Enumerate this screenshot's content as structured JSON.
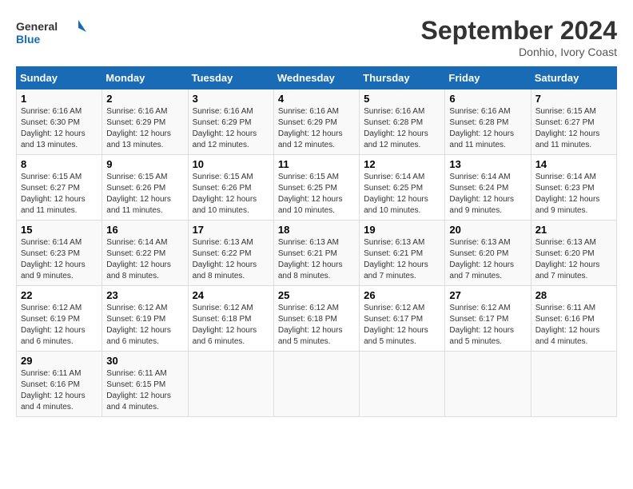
{
  "logo": {
    "line1": "General",
    "line2": "Blue"
  },
  "title": "September 2024",
  "location": "Donhio, Ivory Coast",
  "weekdays": [
    "Sunday",
    "Monday",
    "Tuesday",
    "Wednesday",
    "Thursday",
    "Friday",
    "Saturday"
  ],
  "weeks": [
    [
      {
        "day": "1",
        "info": "Sunrise: 6:16 AM\nSunset: 6:30 PM\nDaylight: 12 hours\nand 13 minutes."
      },
      {
        "day": "2",
        "info": "Sunrise: 6:16 AM\nSunset: 6:29 PM\nDaylight: 12 hours\nand 13 minutes."
      },
      {
        "day": "3",
        "info": "Sunrise: 6:16 AM\nSunset: 6:29 PM\nDaylight: 12 hours\nand 12 minutes."
      },
      {
        "day": "4",
        "info": "Sunrise: 6:16 AM\nSunset: 6:29 PM\nDaylight: 12 hours\nand 12 minutes."
      },
      {
        "day": "5",
        "info": "Sunrise: 6:16 AM\nSunset: 6:28 PM\nDaylight: 12 hours\nand 12 minutes."
      },
      {
        "day": "6",
        "info": "Sunrise: 6:16 AM\nSunset: 6:28 PM\nDaylight: 12 hours\nand 11 minutes."
      },
      {
        "day": "7",
        "info": "Sunrise: 6:15 AM\nSunset: 6:27 PM\nDaylight: 12 hours\nand 11 minutes."
      }
    ],
    [
      {
        "day": "8",
        "info": "Sunrise: 6:15 AM\nSunset: 6:27 PM\nDaylight: 12 hours\nand 11 minutes."
      },
      {
        "day": "9",
        "info": "Sunrise: 6:15 AM\nSunset: 6:26 PM\nDaylight: 12 hours\nand 11 minutes."
      },
      {
        "day": "10",
        "info": "Sunrise: 6:15 AM\nSunset: 6:26 PM\nDaylight: 12 hours\nand 10 minutes."
      },
      {
        "day": "11",
        "info": "Sunrise: 6:15 AM\nSunset: 6:25 PM\nDaylight: 12 hours\nand 10 minutes."
      },
      {
        "day": "12",
        "info": "Sunrise: 6:14 AM\nSunset: 6:25 PM\nDaylight: 12 hours\nand 10 minutes."
      },
      {
        "day": "13",
        "info": "Sunrise: 6:14 AM\nSunset: 6:24 PM\nDaylight: 12 hours\nand 9 minutes."
      },
      {
        "day": "14",
        "info": "Sunrise: 6:14 AM\nSunset: 6:23 PM\nDaylight: 12 hours\nand 9 minutes."
      }
    ],
    [
      {
        "day": "15",
        "info": "Sunrise: 6:14 AM\nSunset: 6:23 PM\nDaylight: 12 hours\nand 9 minutes."
      },
      {
        "day": "16",
        "info": "Sunrise: 6:14 AM\nSunset: 6:22 PM\nDaylight: 12 hours\nand 8 minutes."
      },
      {
        "day": "17",
        "info": "Sunrise: 6:13 AM\nSunset: 6:22 PM\nDaylight: 12 hours\nand 8 minutes."
      },
      {
        "day": "18",
        "info": "Sunrise: 6:13 AM\nSunset: 6:21 PM\nDaylight: 12 hours\nand 8 minutes."
      },
      {
        "day": "19",
        "info": "Sunrise: 6:13 AM\nSunset: 6:21 PM\nDaylight: 12 hours\nand 7 minutes."
      },
      {
        "day": "20",
        "info": "Sunrise: 6:13 AM\nSunset: 6:20 PM\nDaylight: 12 hours\nand 7 minutes."
      },
      {
        "day": "21",
        "info": "Sunrise: 6:13 AM\nSunset: 6:20 PM\nDaylight: 12 hours\nand 7 minutes."
      }
    ],
    [
      {
        "day": "22",
        "info": "Sunrise: 6:12 AM\nSunset: 6:19 PM\nDaylight: 12 hours\nand 6 minutes."
      },
      {
        "day": "23",
        "info": "Sunrise: 6:12 AM\nSunset: 6:19 PM\nDaylight: 12 hours\nand 6 minutes."
      },
      {
        "day": "24",
        "info": "Sunrise: 6:12 AM\nSunset: 6:18 PM\nDaylight: 12 hours\nand 6 minutes."
      },
      {
        "day": "25",
        "info": "Sunrise: 6:12 AM\nSunset: 6:18 PM\nDaylight: 12 hours\nand 5 minutes."
      },
      {
        "day": "26",
        "info": "Sunrise: 6:12 AM\nSunset: 6:17 PM\nDaylight: 12 hours\nand 5 minutes."
      },
      {
        "day": "27",
        "info": "Sunrise: 6:12 AM\nSunset: 6:17 PM\nDaylight: 12 hours\nand 5 minutes."
      },
      {
        "day": "28",
        "info": "Sunrise: 6:11 AM\nSunset: 6:16 PM\nDaylight: 12 hours\nand 4 minutes."
      }
    ],
    [
      {
        "day": "29",
        "info": "Sunrise: 6:11 AM\nSunset: 6:16 PM\nDaylight: 12 hours\nand 4 minutes."
      },
      {
        "day": "30",
        "info": "Sunrise: 6:11 AM\nSunset: 6:15 PM\nDaylight: 12 hours\nand 4 minutes."
      },
      {
        "day": "",
        "info": ""
      },
      {
        "day": "",
        "info": ""
      },
      {
        "day": "",
        "info": ""
      },
      {
        "day": "",
        "info": ""
      },
      {
        "day": "",
        "info": ""
      }
    ]
  ]
}
